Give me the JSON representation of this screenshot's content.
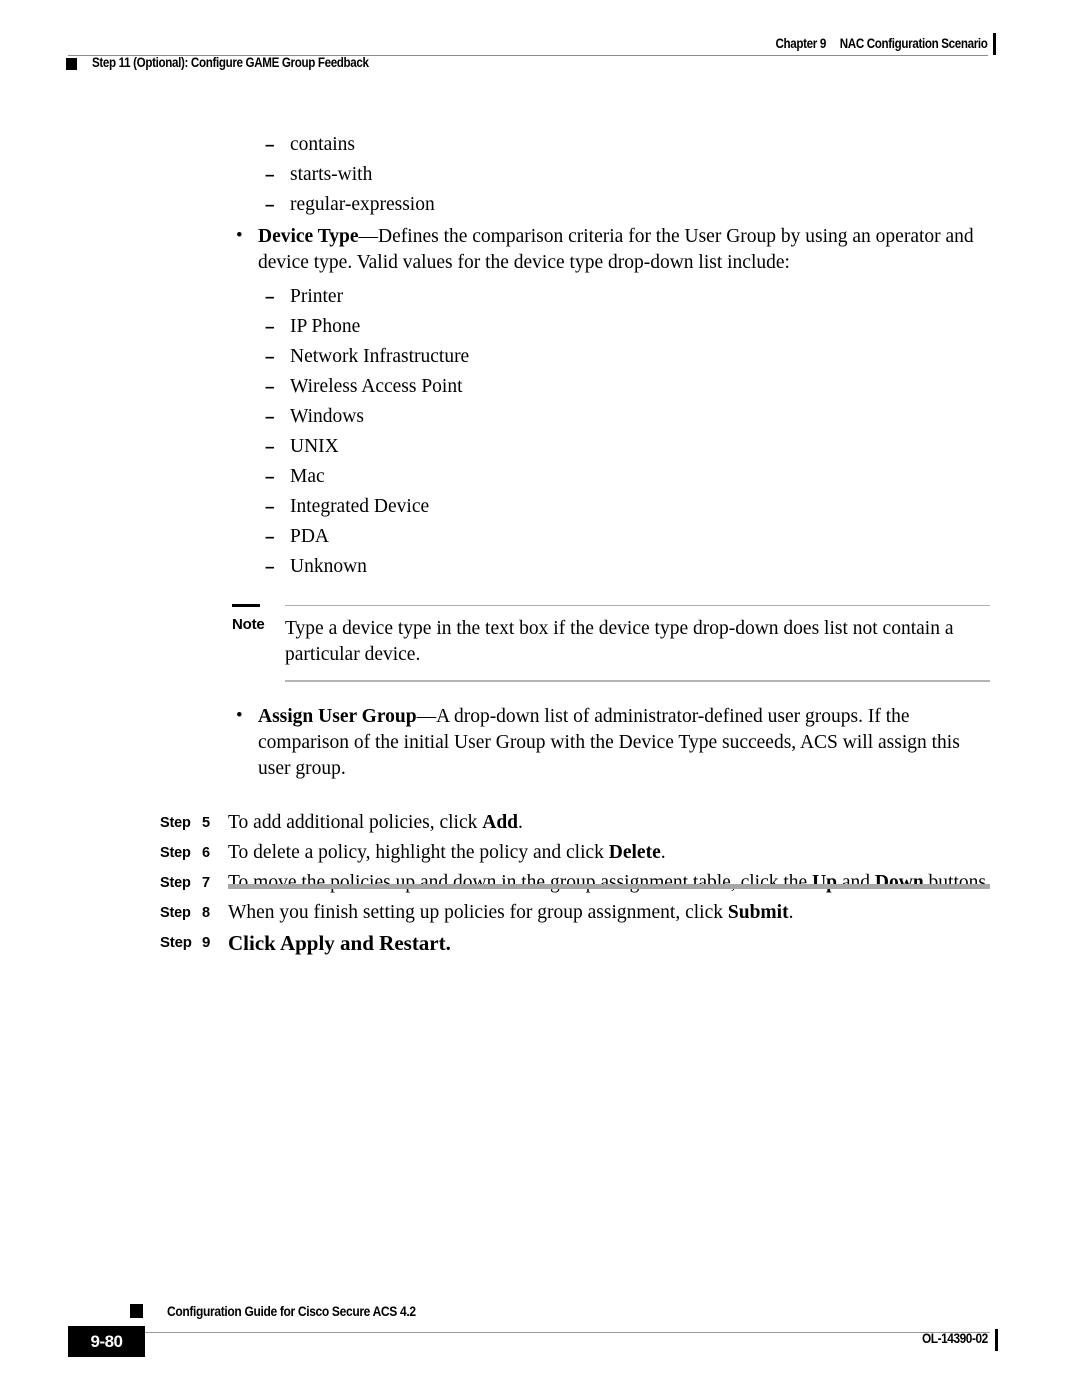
{
  "header": {
    "chapter_label": "Chapter 9",
    "chapter_title": "NAC Configuration Scenario",
    "section_title": "Step 11 (Optional): Configure GAME Group Feedback"
  },
  "body": {
    "operator_values": [
      "contains",
      "starts-with",
      "regular-expression"
    ],
    "device_type_bullet": {
      "term": "Device Type",
      "text": "—Defines the comparison criteria for the User Group by using an operator and device type. Valid values for the device type drop-down list include:"
    },
    "device_type_values": [
      "Printer",
      "IP Phone",
      "Network Infrastructure",
      "Wireless Access Point",
      "Windows",
      "UNIX",
      "Mac",
      "Integrated Device",
      "PDA",
      "Unknown"
    ],
    "note": {
      "label": "Note",
      "text": "Type a device type in the text box if the device type drop-down does list not contain a particular device."
    },
    "assign_user_group_bullet": {
      "term": "Assign User Group",
      "text": "—A drop-down list of administrator-defined user groups. If the comparison of the initial User Group with the Device Type succeeds, ACS will assign this user group."
    }
  },
  "steps": {
    "word": "Step",
    "items": [
      {
        "number": "5",
        "pre": "To add additional policies, click ",
        "bold": "Add",
        "post": "."
      },
      {
        "number": "6",
        "pre": "To delete a policy, highlight the policy and click ",
        "bold": "Delete",
        "post": "."
      },
      {
        "number": "7",
        "pre": "To move the policies up and down in the group assignment table, click the ",
        "bold": "Up",
        "mid": " and ",
        "bold2": "Down",
        "post": " buttons."
      },
      {
        "number": "8",
        "pre": "When you finish setting up policies for group assignment, click ",
        "bold": "Submit",
        "post": "."
      },
      {
        "number": "9",
        "pre": "Click ",
        "bold": "Apply and Restart.",
        "post": ""
      }
    ]
  },
  "footer": {
    "page_number": "9-80",
    "guide_title": "Configuration Guide for Cisco Secure ACS 4.2",
    "doc_id": "OL-14390-02"
  },
  "colors": {
    "rule_gray": "#9a9a9a",
    "thick_rule_gray": "#a8a8a8",
    "ink": "#000000",
    "paper": "#ffffff"
  }
}
